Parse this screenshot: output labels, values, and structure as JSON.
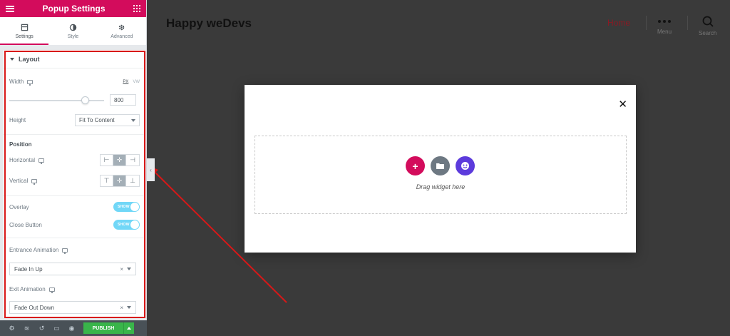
{
  "panel": {
    "title": "Popup Settings",
    "tabs": [
      {
        "label": "Settings",
        "icon": "settings-tab-icon"
      },
      {
        "label": "Style",
        "icon": "contrast-icon"
      },
      {
        "label": "Advanced",
        "icon": "gear-icon"
      }
    ],
    "layout": {
      "section_title": "Layout",
      "width_label": "Width",
      "units": [
        "PX",
        "VW"
      ],
      "width_value": "800",
      "width_slider_fraction": 0.8,
      "height_label": "Height",
      "height_value": "Fit To Content",
      "position_title": "Position",
      "horizontal_label": "Horizontal",
      "horizontal_selected": "center",
      "vertical_label": "Vertical",
      "vertical_selected": "middle",
      "overlay_label": "Overlay",
      "overlay_state": "SHOW",
      "close_button_label": "Close Button",
      "close_button_state": "SHOW",
      "entrance_label": "Entrance Animation",
      "entrance_value": "Fade In Up",
      "exit_label": "Exit Animation",
      "exit_value": "Fade Out Down"
    },
    "footer": {
      "publish_label": "PUBLISH",
      "icons": [
        "gear-icon",
        "layers-icon",
        "history-icon",
        "responsive-icon",
        "eye-icon"
      ]
    }
  },
  "site": {
    "title": "Happy weDevs",
    "nav_home": "Home",
    "menu_label": "Menu",
    "search_label": "Search"
  },
  "popup": {
    "drag_text": "Drag widget here"
  },
  "colors": {
    "accent": "#d30c5c",
    "switch": "#71d7f7",
    "publish": "#39b54a",
    "annotation": "#d81818",
    "add_circle": "#d30c5c",
    "folder_circle": "#6d7882",
    "happy_circle": "#5c3bdc"
  }
}
